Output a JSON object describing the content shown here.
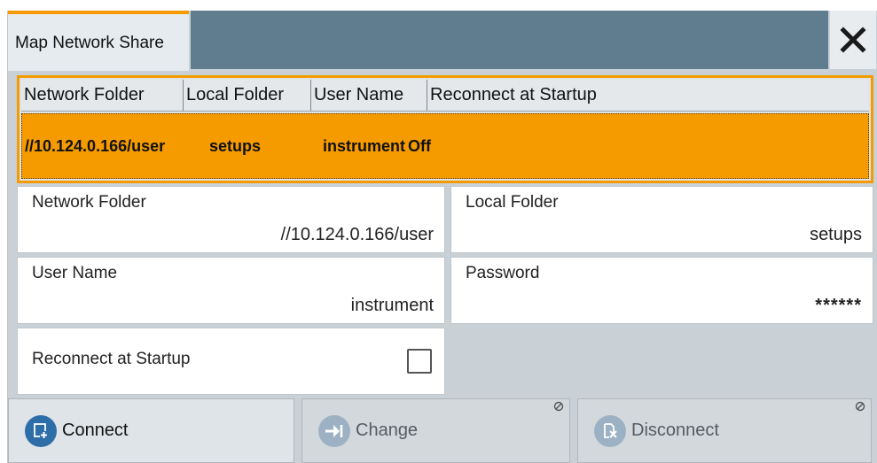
{
  "dialog": {
    "title": "Map Network Share",
    "close_icon": "close-icon"
  },
  "list": {
    "columns": [
      "Network Folder",
      "Local Folder",
      "User Name",
      "Reconnect at Startup"
    ],
    "rows": [
      {
        "network_folder": "//10.124.0.166/user",
        "local_folder": "setups",
        "user_name": "instrument",
        "reconnect": "Off"
      }
    ],
    "selected_row_color": "#f59b00"
  },
  "form": {
    "network_folder": {
      "label": "Network Folder",
      "value": "//10.124.0.166/user"
    },
    "local_folder": {
      "label": "Local Folder",
      "value": "setups"
    },
    "user_name": {
      "label": "User Name",
      "value": "instrument"
    },
    "password": {
      "label": "Password",
      "value": "******"
    },
    "reconnect": {
      "label": "Reconnect at Startup",
      "checked": false
    }
  },
  "buttons": {
    "connect": {
      "label": "Connect",
      "icon": "connect-icon",
      "enabled": true
    },
    "change": {
      "label": "Change",
      "icon": "change-arrow-icon",
      "enabled": false
    },
    "disconnect": {
      "label": "Disconnect",
      "icon": "disconnect-icon",
      "enabled": false
    }
  },
  "colors": {
    "accent": "#f59b00",
    "titlebar": "#607d8f",
    "button_icon": "#2d6ea8"
  }
}
